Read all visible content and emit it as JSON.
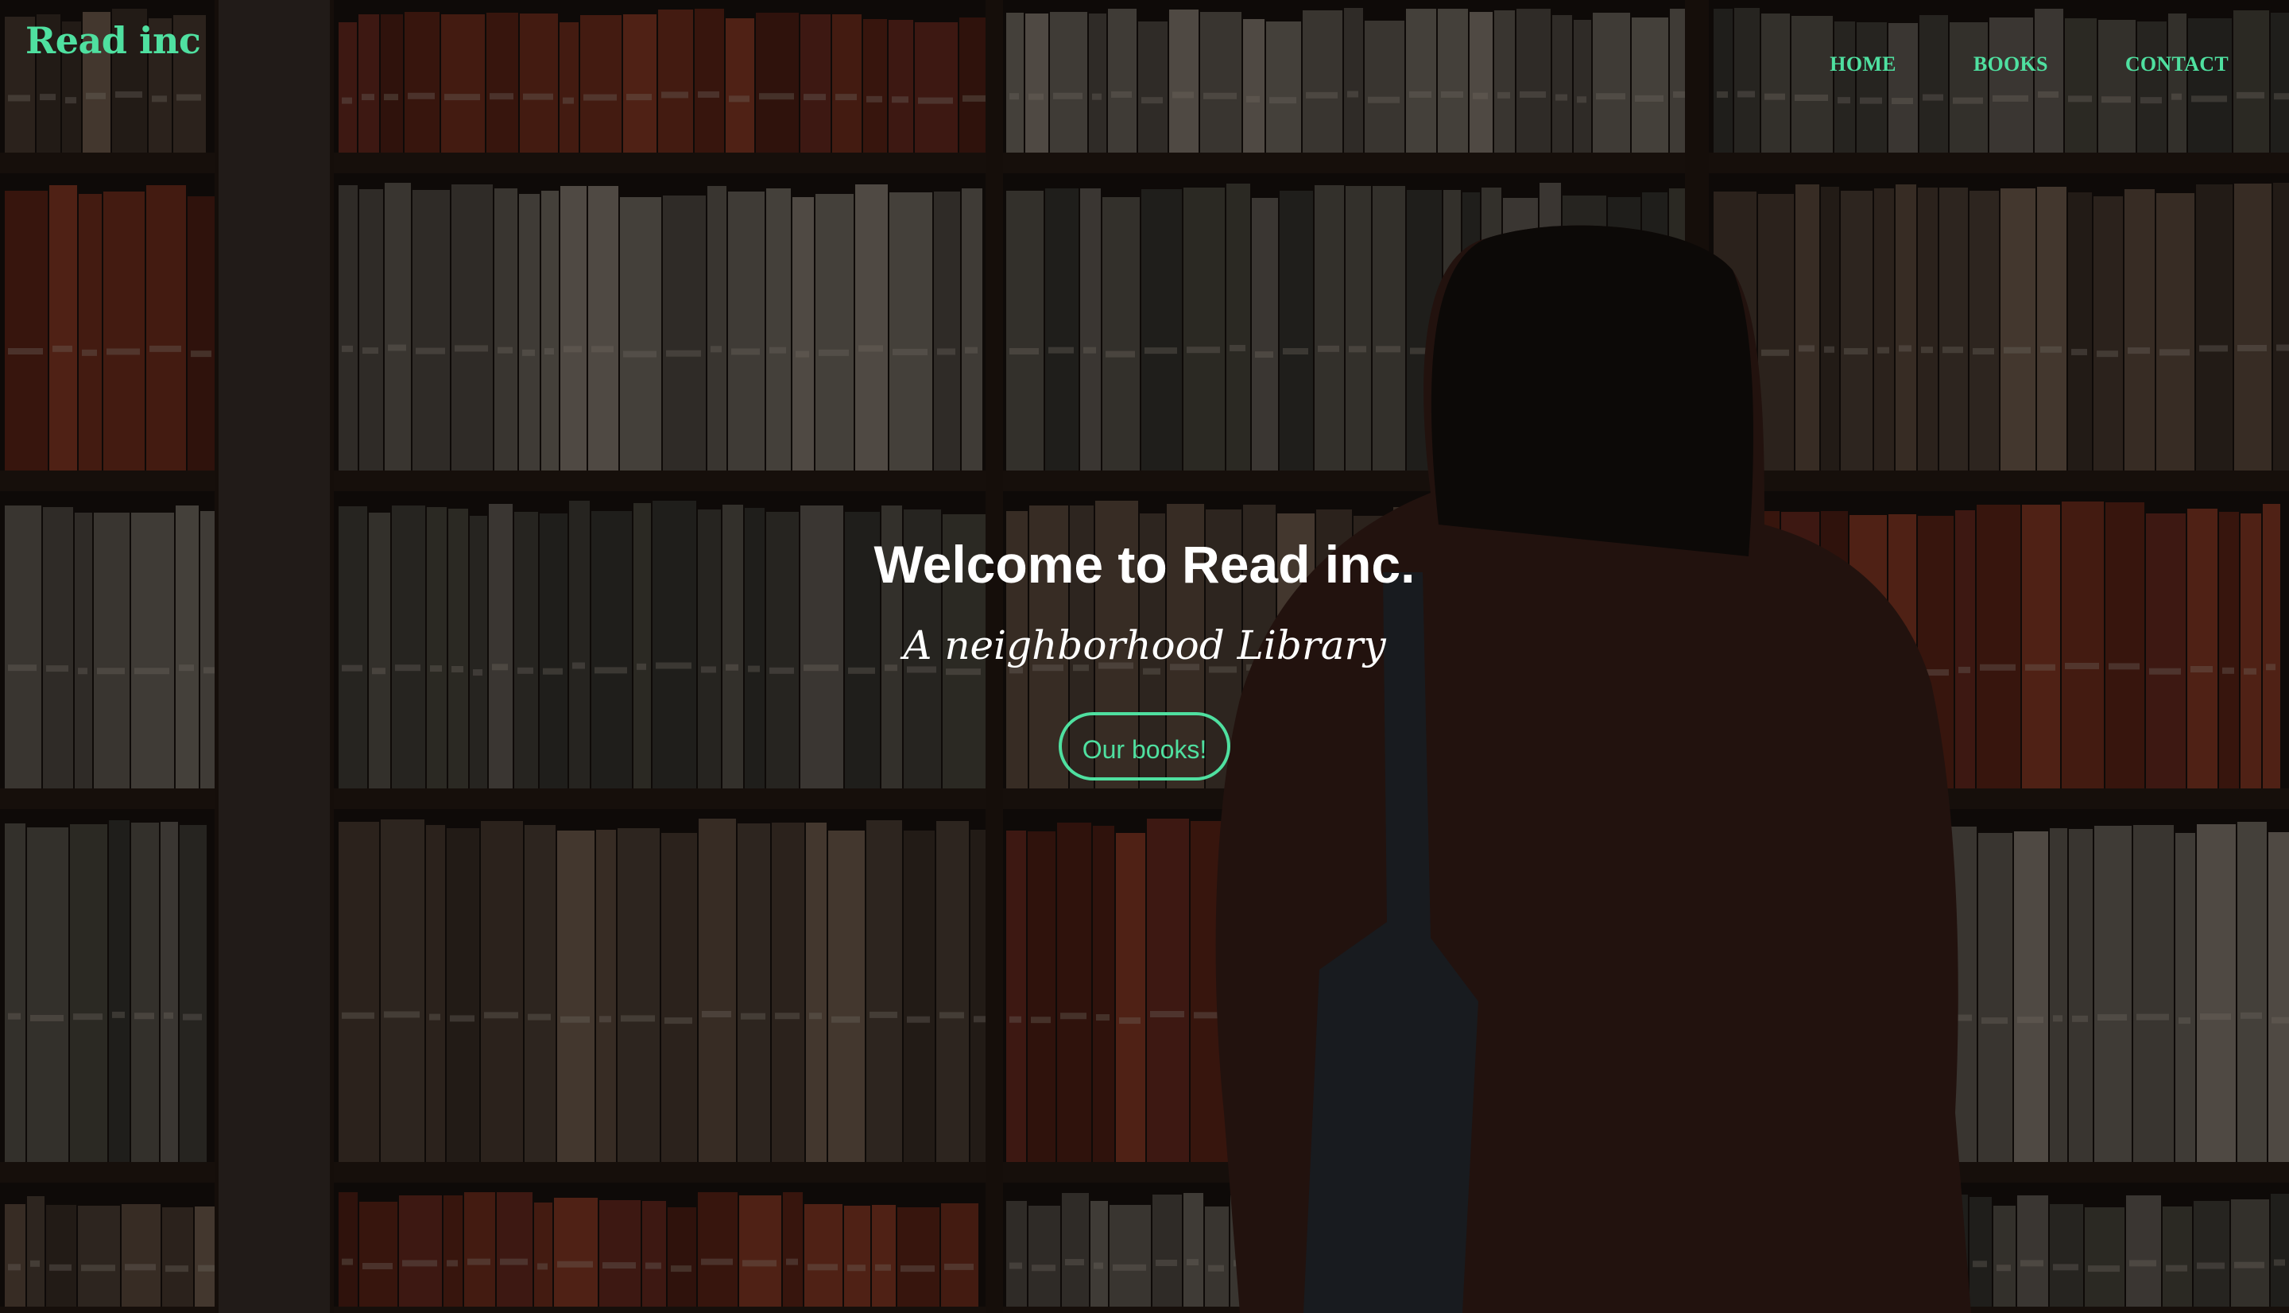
{
  "brand": {
    "name": "Read inc",
    "color": "#4fe0a0"
  },
  "nav": {
    "items": [
      {
        "label": "HOME"
      },
      {
        "label": "BOOKS"
      },
      {
        "label": "CONTACT"
      }
    ]
  },
  "hero": {
    "title": "Welcome to Read inc.",
    "subtitle": "A neighborhood Library",
    "cta_label": "Our books!",
    "background_description_icon": "bookshelf-photo"
  },
  "colors": {
    "accent": "#4fe0a0",
    "text": "#ffffff",
    "background": "#0e0a08"
  }
}
